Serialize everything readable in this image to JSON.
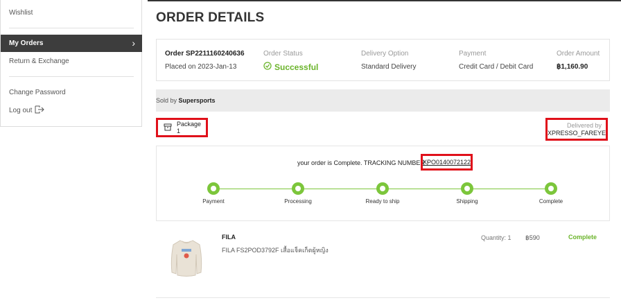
{
  "sidebar": {
    "wishlist": "Wishlist",
    "my_orders": "My Orders",
    "return_exchange": "Return & Exchange",
    "change_password": "Change Password",
    "log_out": "Log out"
  },
  "page": {
    "title": "ORDER DETAILS"
  },
  "order": {
    "number_label": "Order SP2211160240636",
    "placed_on": "Placed on 2023-Jan-13",
    "status_label": "Order Status",
    "status_value": "Successful",
    "delivery_label": "Delivery Option",
    "delivery_value": "Standard Delivery",
    "payment_label": "Payment",
    "payment_value": "Credit Card / Debit Card",
    "amount_label": "Order Amount",
    "amount_value": "฿1,160.90"
  },
  "seller": {
    "prefix": "Sold by ",
    "name": "Supersports"
  },
  "package": {
    "label": "Package 1",
    "delivered_by_label": "Delivered by",
    "delivered_by_value": "XPRESSO_FAREYE"
  },
  "tracking": {
    "text": "your order is Complete. TRACKING NUMBER :",
    "number": "XPO0140072122",
    "steps": [
      "Payment",
      "Processing",
      "Ready to ship",
      "Shipping",
      "Complete"
    ]
  },
  "item": {
    "brand": "FILA",
    "name": "FILA FS2POD3792F เสื้อแจ็คเก็ตผู้หญิง",
    "quantity": "Quantity: 1",
    "price": "฿590",
    "status": "Complete"
  },
  "colors": {
    "accent_green": "#7cc63b",
    "highlight_red": "#e0101a",
    "sidebar_active": "#3d3d3d"
  }
}
